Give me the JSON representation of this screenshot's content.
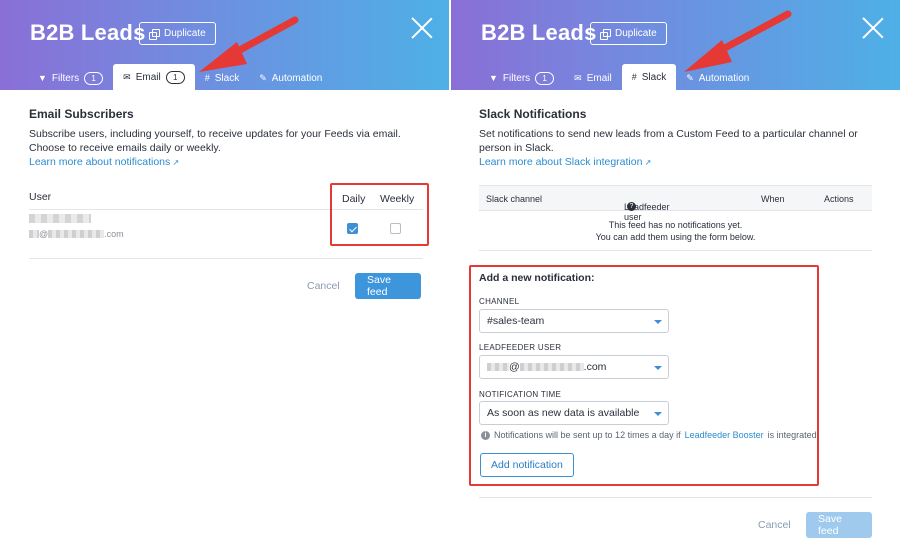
{
  "left": {
    "title": "B2B Leads",
    "duplicate_label": "Duplicate",
    "tabs": [
      {
        "label": "Filters",
        "icon": "filter-icon",
        "count": "1",
        "active": false
      },
      {
        "label": "Email",
        "icon": "envelope-icon",
        "count": "1",
        "active": true
      },
      {
        "label": "Slack",
        "icon": "slack-icon",
        "count": "",
        "active": false
      },
      {
        "label": "Automation",
        "icon": "wand-icon",
        "count": "",
        "active": false
      }
    ],
    "section_title": "Email Subscribers",
    "description": "Subscribe users, including yourself, to receive updates for your Feeds via email. Choose to receive emails daily or weekly.",
    "learn_more": "Learn more about notifications",
    "table": {
      "user_header": "User",
      "daily_header": "Daily",
      "weekly_header": "Weekly",
      "row": {
        "email_domain": ".com",
        "daily": true,
        "weekly": false
      }
    },
    "cancel_label": "Cancel",
    "save_label": "Save feed"
  },
  "right": {
    "title": "B2B Leads",
    "duplicate_label": "Duplicate",
    "tabs": [
      {
        "label": "Filters",
        "icon": "filter-icon",
        "count": "1",
        "active": false
      },
      {
        "label": "Email",
        "icon": "envelope-icon",
        "count": "",
        "active": false
      },
      {
        "label": "Slack",
        "icon": "slack-icon",
        "count": "",
        "active": true
      },
      {
        "label": "Automation",
        "icon": "wand-icon",
        "count": "",
        "active": false
      }
    ],
    "section_title": "Slack Notifications",
    "description": "Set notifications to send new leads from a Custom Feed to a particular channel or person in Slack.",
    "learn_more": "Learn more about Slack integration",
    "table": {
      "headers": [
        "Slack channel",
        "Leadfeeder user",
        "When",
        "Actions"
      ],
      "empty_line1": "This feed has no notifications yet.",
      "empty_line2": "You can add them using the form below."
    },
    "form": {
      "title": "Add a new notification:",
      "channel_label": "CHANNEL",
      "channel_value": "#sales-team",
      "user_label": "LEADFEEDER USER",
      "user_at": "@",
      "user_domain": ".com",
      "time_label": "NOTIFICATION TIME",
      "time_value": "As soon as new data is available",
      "info_text": "Notifications will be sent up to 12 times a day if",
      "info_link": "Leadfeeder Booster",
      "info_suffix": "is integrated.",
      "add_label": "Add notification"
    },
    "cancel_label": "Cancel",
    "save_label": "Save feed"
  },
  "colors": {
    "accent": "#3d95dc",
    "highlight": "#e53935",
    "header_start": "#8a6fd6",
    "header_end": "#4eb0e6"
  }
}
